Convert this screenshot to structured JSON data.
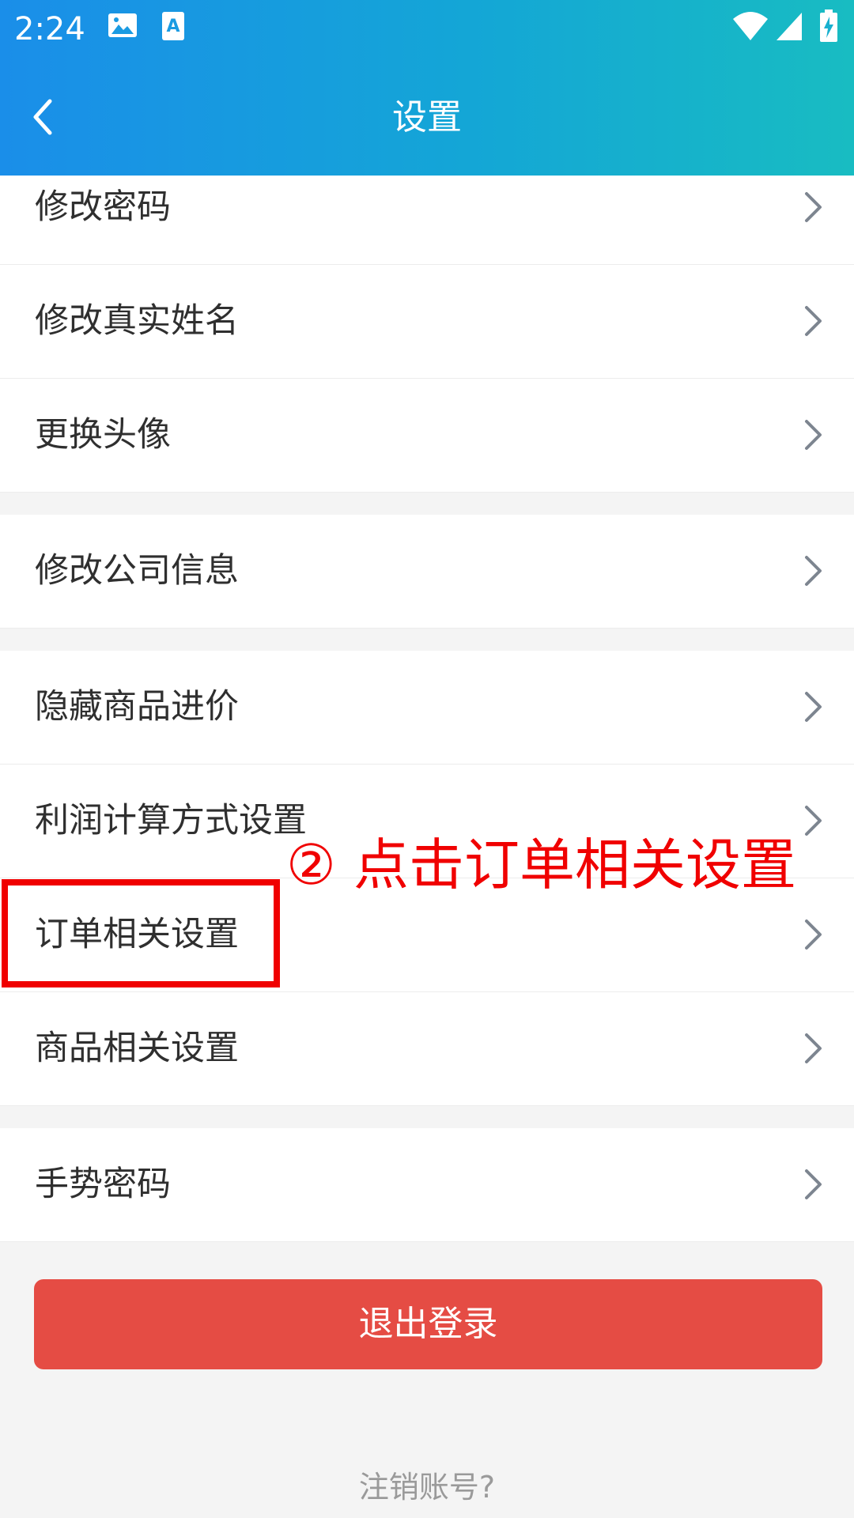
{
  "status_bar": {
    "time": "2:24"
  },
  "header": {
    "title": "设置"
  },
  "menu": {
    "group1": [
      {
        "label": "修改密码"
      },
      {
        "label": "修改真实姓名"
      },
      {
        "label": "更换头像"
      }
    ],
    "group2": [
      {
        "label": "修改公司信息"
      }
    ],
    "group3": [
      {
        "label": "隐藏商品进价"
      },
      {
        "label": "利润计算方式设置"
      },
      {
        "label": "订单相关设置"
      },
      {
        "label": "商品相关设置"
      }
    ],
    "group4": [
      {
        "label": "手势密码"
      }
    ]
  },
  "logout_button": "退出登录",
  "cancel_account_link": "注销账号?",
  "annotation": {
    "text": "② 点击订单相关设置",
    "color": "#f00000"
  },
  "colors": {
    "header_gradient_start": "#1a8ee9",
    "header_gradient_end": "#18bcc2",
    "logout_red": "#e54c44"
  }
}
